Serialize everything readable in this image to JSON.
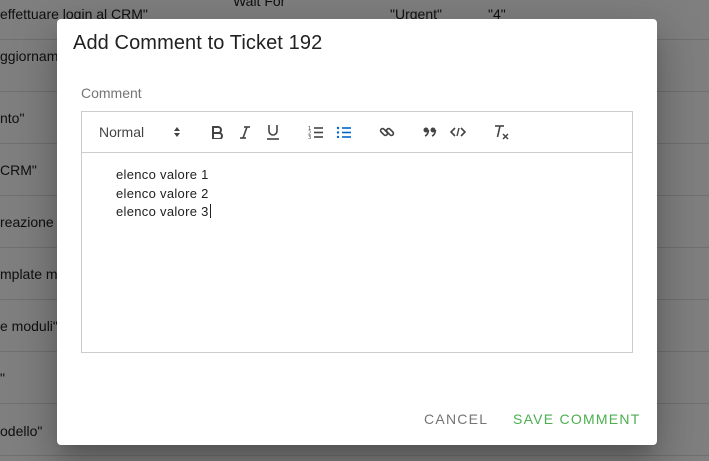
{
  "background_table": {
    "rows": [
      {
        "col1": "effettuare login al CRM\"",
        "col2": "\"Wait For",
        "col3": "\"Urgent\"",
        "col4": "\"4\""
      },
      {
        "col1": "ggiornamen",
        "col2": "",
        "col3": "",
        "col4": ""
      },
      {
        "col1": "nto\"",
        "col2": "",
        "col3": "",
        "col4": ""
      },
      {
        "col1": "CRM\"",
        "col2": "",
        "col3": "",
        "col4": ""
      },
      {
        "col1": "reazione d",
        "col2": "",
        "col3": "",
        "col4": ""
      },
      {
        "col1": "mplate m",
        "col2": "",
        "col3": "",
        "col4": ""
      },
      {
        "col1": "e moduli\"",
        "col2": "",
        "col3": "",
        "col4": ""
      },
      {
        "col1": "\"",
        "col2": "",
        "col3": "",
        "col4": ""
      },
      {
        "col1": "odello\"",
        "col2": "",
        "col3": "",
        "col4": ""
      }
    ]
  },
  "dialog": {
    "title": "Add Comment to Ticket 192",
    "field_label": "Comment",
    "toolbar": {
      "format_select": "Normal",
      "buttons": [
        {
          "name": "bold-icon",
          "active": false
        },
        {
          "name": "italic-icon",
          "active": false
        },
        {
          "name": "underline-icon",
          "active": false
        },
        {
          "name": "ordered-list-icon",
          "active": false
        },
        {
          "name": "bullet-list-icon",
          "active": true
        },
        {
          "name": "link-icon",
          "active": false
        },
        {
          "name": "blockquote-icon",
          "active": false
        },
        {
          "name": "code-icon",
          "active": false
        },
        {
          "name": "clear-format-icon",
          "active": false
        }
      ]
    },
    "content_items": [
      "elenco valore 1",
      "elenco valore 2",
      "elenco valore 3"
    ],
    "actions": {
      "cancel": "CANCEL",
      "save": "SAVE COMMENT"
    }
  },
  "colors": {
    "accent_active": "#06c",
    "save_green": "#4caf50",
    "backdrop": "rgba(0,0,0,0.5)"
  }
}
